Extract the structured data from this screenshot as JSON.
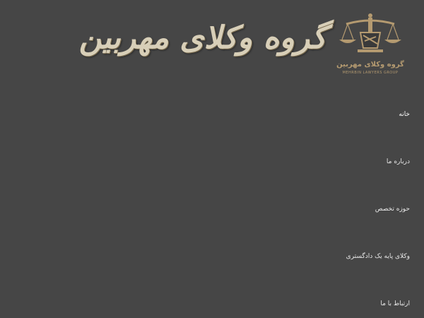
{
  "brand": {
    "title": "گروه وکلای مهربین",
    "logo_text_fa": "گروه وکلای مهربین",
    "logo_text_en": "MEHRBIN LAWYERS GROUP",
    "logo_icon": "scales-of-justice-icon",
    "gold_color": "#b49a70",
    "title_color": "#d8cfb8"
  },
  "nav": {
    "items": [
      {
        "label": "خانه"
      },
      {
        "label": "درباره ما"
      },
      {
        "label": "حوزه تخصص"
      },
      {
        "label": "وکلای پایه یک دادگستری"
      },
      {
        "label": "ارتباط با ما"
      }
    ]
  },
  "background_color": "#464646"
}
